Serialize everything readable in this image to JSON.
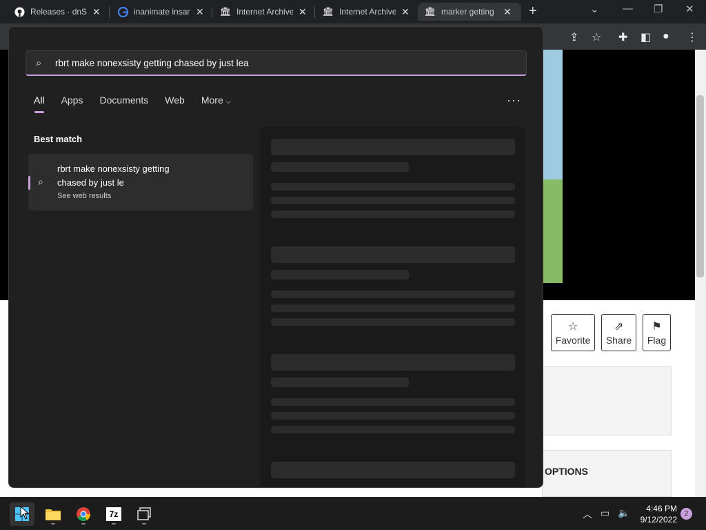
{
  "tabs": [
    {
      "title": "Releases · dnSpy",
      "icon": "github-icon"
    },
    {
      "title": "inanimate insanity",
      "icon": "google-icon"
    },
    {
      "title": "Internet Archive",
      "icon": "archive-icon"
    },
    {
      "title": "Internet Archive",
      "icon": "archive-icon"
    },
    {
      "title": "marker getting",
      "icon": "archive-icon"
    }
  ],
  "page": {
    "buttons": {
      "favorite": "Favorite",
      "share": "Share",
      "flag": "Flag"
    },
    "options_heading": "OPTIONS"
  },
  "search": {
    "query": "rbrt make nonexsisty getting chased by just lea",
    "filters": [
      "All",
      "Apps",
      "Documents",
      "Web",
      "More"
    ],
    "best_match_label": "Best match",
    "result": {
      "title": "rbrt make nonexsisty getting chased by just le",
      "subtitle": "See web results"
    }
  },
  "taskbar": {
    "time": "4:46 PM",
    "date": "9/12/2022",
    "notifications": "2",
    "pinned": [
      "start-button",
      "file-explorer",
      "chrome",
      "7zip",
      "task-view"
    ]
  },
  "colors": {
    "accent": "#c9a0dc",
    "panel_bg": "#202020",
    "chrome_bg": "#202124"
  }
}
